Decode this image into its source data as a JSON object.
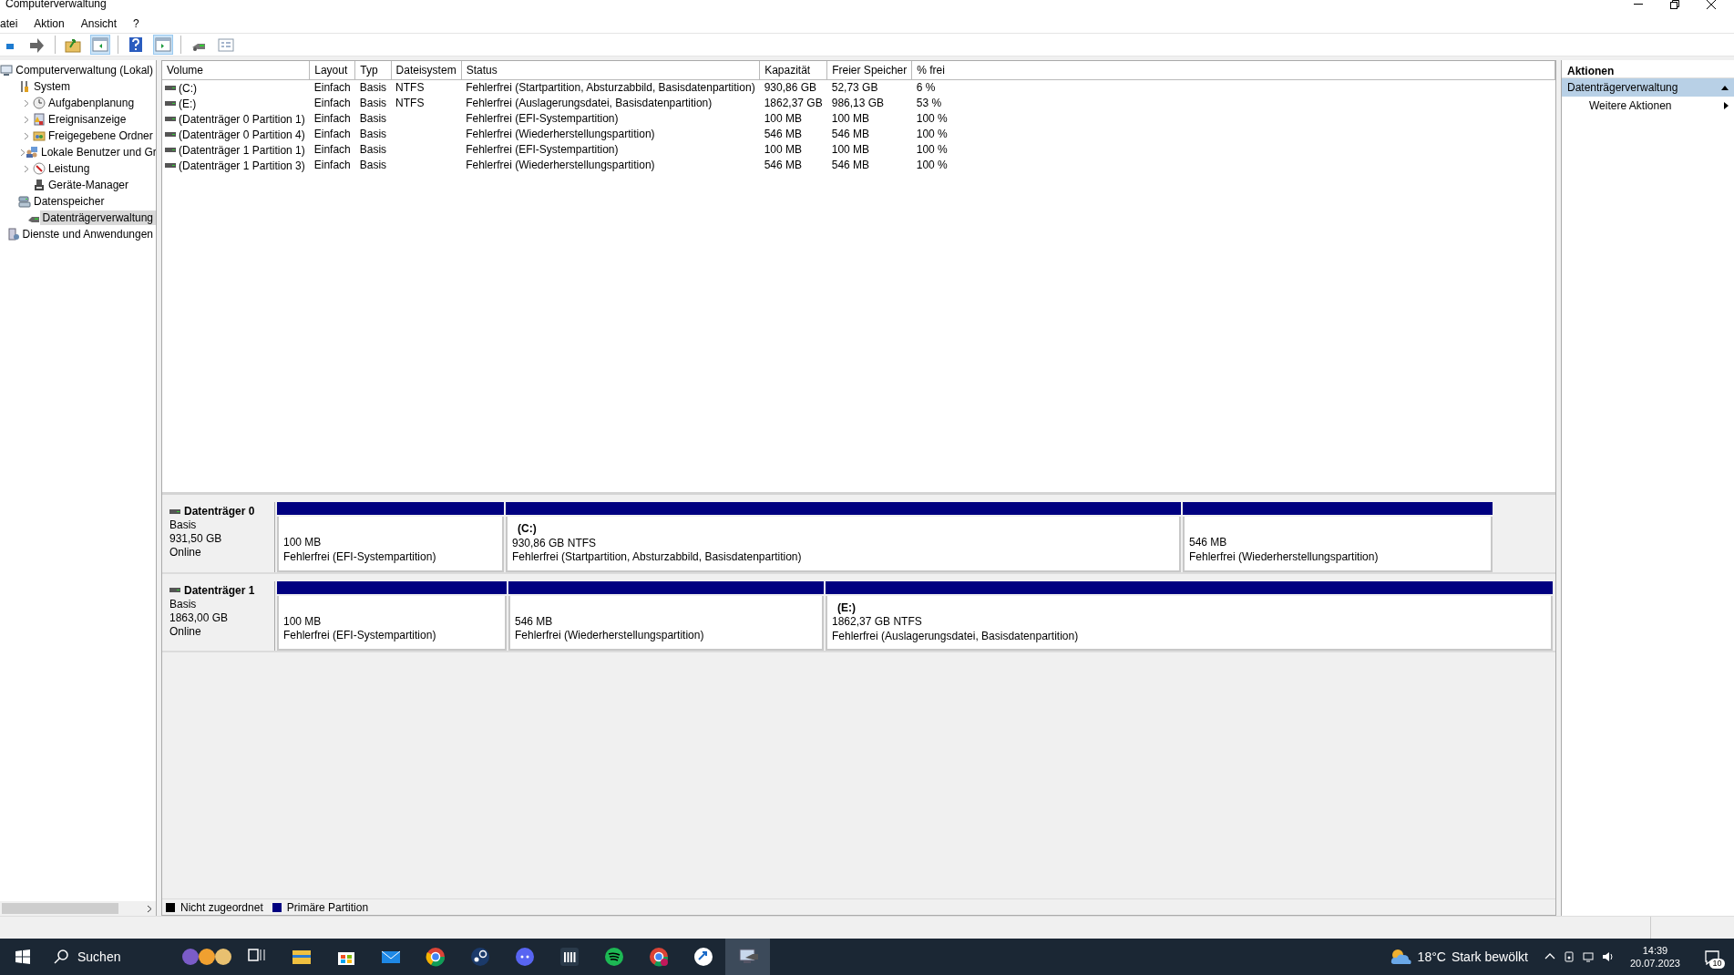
{
  "window": {
    "title": "Computerverwaltung"
  },
  "menu": [
    "atei",
    "Aktion",
    "Ansicht",
    "?"
  ],
  "tree": [
    {
      "label": "Computerverwaltung (Lokal)",
      "expandable": false,
      "selected": false,
      "children": [
        {
          "label": "System",
          "expandable": false,
          "selected": false,
          "children": [
            {
              "label": "Aufgabenplanung",
              "expandable": true,
              "selected": false
            },
            {
              "label": "Ereignisanzeige",
              "expandable": true,
              "selected": false
            },
            {
              "label": "Freigegebene Ordner",
              "expandable": true,
              "selected": false
            },
            {
              "label": "Lokale Benutzer und Gr",
              "expandable": true,
              "selected": false
            },
            {
              "label": "Leistung",
              "expandable": true,
              "selected": false
            },
            {
              "label": "Geräte-Manager",
              "expandable": false,
              "selected": false
            }
          ]
        },
        {
          "label": "Datenspeicher",
          "expandable": false,
          "selected": false,
          "children": [
            {
              "label": "Datenträgerverwaltung",
              "expandable": false,
              "selected": true
            }
          ]
        },
        {
          "label": "Dienste und Anwendungen",
          "expandable": false,
          "selected": false
        }
      ]
    }
  ],
  "table": {
    "columns": [
      "Volume",
      "Layout",
      "Typ",
      "Dateisystem",
      "Status",
      "Kapazität",
      "Freier Speicher",
      "% frei"
    ],
    "rows": [
      {
        "volume": "(C:)",
        "layout": "Einfach",
        "type": "Basis",
        "file_system": "NTFS",
        "status": "Fehlerfrei (Startpartition, Absturzabbild, Basisdatenpartition)",
        "capacity": "930,86 GB",
        "free_space": "52,73 GB",
        "percent_free": "6 %"
      },
      {
        "volume": "(E:)",
        "layout": "Einfach",
        "type": "Basis",
        "file_system": "NTFS",
        "status": "Fehlerfrei (Auslagerungsdatei, Basisdatenpartition)",
        "capacity": "1862,37 GB",
        "free_space": "986,13 GB",
        "percent_free": "53 %"
      },
      {
        "volume": "(Datenträger 0 Partition 1)",
        "layout": "Einfach",
        "type": "Basis",
        "status": "Fehlerfrei (EFI-Systempartition)",
        "capacity": "100 MB",
        "free_space": "100 MB",
        "percent_free": "100 %"
      },
      {
        "volume": "(Datenträger 0 Partition 4)",
        "layout": "Einfach",
        "type": "Basis",
        "status": "Fehlerfrei (Wiederherstellungspartition)",
        "capacity": "546 MB",
        "free_space": "546 MB",
        "percent_free": "100 %"
      },
      {
        "volume": "(Datenträger 1 Partition 1)",
        "layout": "Einfach",
        "type": "Basis",
        "status": "Fehlerfrei (EFI-Systempartition)",
        "capacity": "100 MB",
        "free_space": "100 MB",
        "percent_free": "100 %"
      },
      {
        "volume": "(Datenträger 1 Partition 3)",
        "layout": "Einfach",
        "type": "Basis",
        "status": "Fehlerfrei (Wiederherstellungspartition)",
        "capacity": "546 MB",
        "free_space": "546 MB",
        "percent_free": "100 %"
      }
    ]
  },
  "disks": [
    {
      "name": "Datenträger 0",
      "type": "Basis",
      "size": "931,50 GB",
      "state": "Online",
      "partitions": [
        {
          "size": "100 MB",
          "status": "Fehlerfrei (EFI-Systempartition)",
          "color": "#000080"
        },
        {
          "label": "(C:)",
          "size": "930,86 GB NTFS",
          "status": "Fehlerfrei (Startpartition, Absturzabbild, Basisdatenpartition)",
          "color": "#000080"
        },
        {
          "size": "546 MB",
          "status": "Fehlerfrei (Wiederherstellungspartition)",
          "color": "#000080"
        }
      ]
    },
    {
      "name": "Datenträger 1",
      "type": "Basis",
      "size": "1863,00 GB",
      "state": "Online",
      "partitions": [
        {
          "size": "100 MB",
          "status": "Fehlerfrei (EFI-Systempartition)",
          "color": "#000080"
        },
        {
          "size": "546 MB",
          "status": "Fehlerfrei (Wiederherstellungspartition)",
          "color": "#000080"
        },
        {
          "label": "(E:)",
          "size": "1862,37 GB NTFS",
          "status": "Fehlerfrei (Auslagerungsdatei, Basisdatenpartition)",
          "color": "#000080"
        }
      ]
    }
  ],
  "legend": [
    {
      "label": "Nicht zugeordnet",
      "color": "#000000"
    },
    {
      "label": "Primäre Partition",
      "color": "#000080"
    }
  ],
  "actions": {
    "title": "Aktionen",
    "items": [
      {
        "label": "Datenträgerverwaltung",
        "kind": "section"
      },
      {
        "label": "Weitere Aktionen",
        "kind": "action"
      }
    ]
  },
  "taskbar": {
    "search": {
      "placeholder": "Suchen"
    },
    "weather": {
      "temperature": "18°C",
      "text": "Stark bewölkt"
    },
    "time": "14:39",
    "date": "20.07.2023",
    "notifications": "10"
  }
}
